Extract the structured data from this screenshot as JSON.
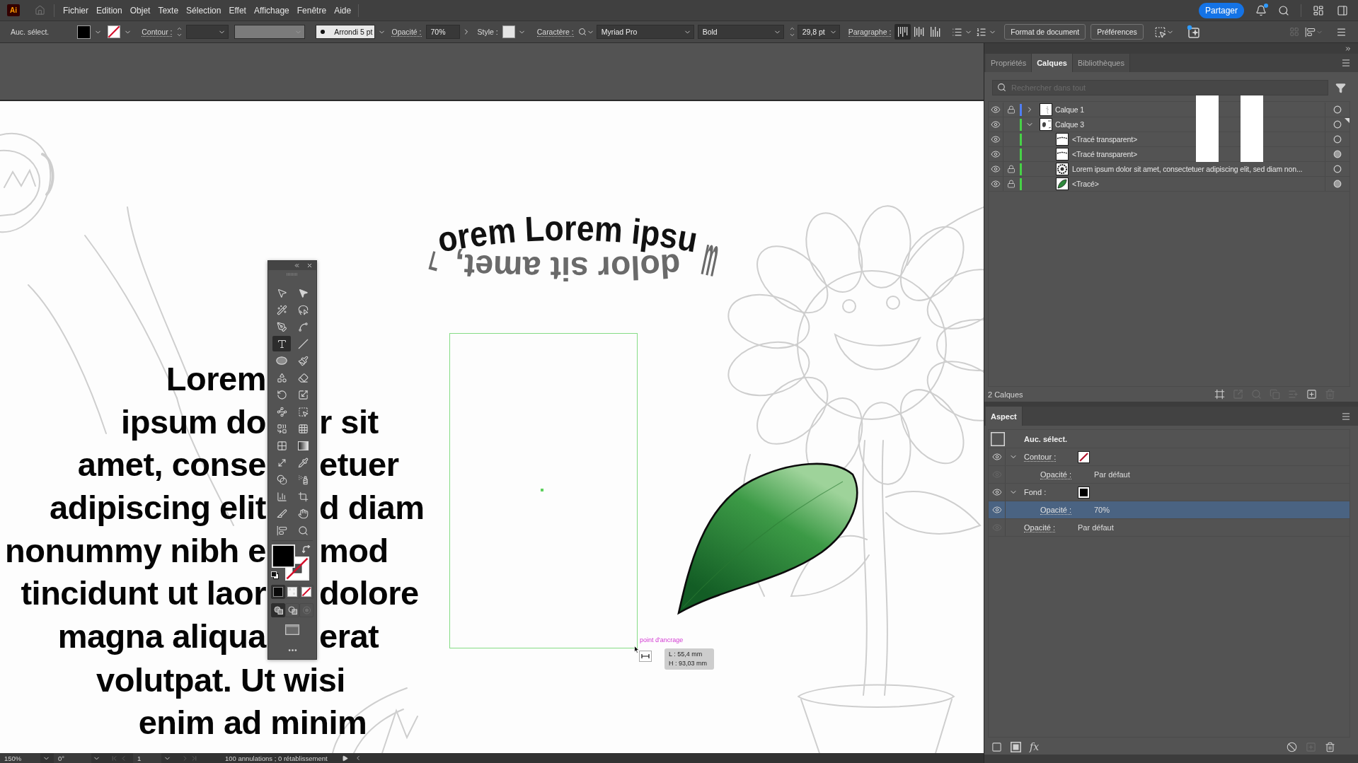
{
  "menu_bar": {
    "logo": "Ai",
    "items": [
      "Fichier",
      "Edition",
      "Objet",
      "Texte",
      "Sélection",
      "Effet",
      "Affichage",
      "Fenêtre",
      "Aide"
    ],
    "share_button": "Partager",
    "notification_dot": true
  },
  "control_bar": {
    "selection": "Auc. sélect.",
    "fill": {
      "color": "#000000"
    },
    "stroke": {
      "none": true
    },
    "stroke_label": "Contour :",
    "profile_disabled": true,
    "brush": "Arrondi 5 pt",
    "opacity_label": "Opacité :",
    "opacity": "70%",
    "style_label": "Style :",
    "character_label": "Caractère :",
    "font_family": "Myriad Pro",
    "font_style": "Bold",
    "font_size": "29,8 pt",
    "paragraph_label": "Paragraphe :",
    "alignments": [
      {
        "kind": "top",
        "selected": true
      },
      {
        "kind": "center",
        "selected": false
      },
      {
        "kind": "bottom",
        "selected": false
      }
    ],
    "buttons": [
      "Format de document",
      "Préférences"
    ]
  },
  "tool_panel": {
    "tools": [
      {
        "kind": "selection",
        "selected": false
      },
      {
        "kind": "direct-selection",
        "selected": false
      },
      {
        "kind": "magic-wand",
        "selected": false
      },
      {
        "kind": "lasso",
        "selected": false
      },
      {
        "kind": "pen",
        "selected": false
      },
      {
        "kind": "curvature",
        "selected": false
      },
      {
        "kind": "type",
        "selected": true
      },
      {
        "kind": "line",
        "selected": false
      },
      {
        "kind": "ellipse",
        "selected": false
      },
      {
        "kind": "paintbrush",
        "selected": false
      },
      {
        "kind": "shaper",
        "selected": false
      },
      {
        "kind": "eraser",
        "selected": false
      },
      {
        "kind": "rotate",
        "selected": false
      },
      {
        "kind": "scale",
        "selected": false
      },
      {
        "kind": "puppet-warp",
        "selected": false
      },
      {
        "kind": "free-transform",
        "selected": false
      },
      {
        "kind": "shape-builder",
        "selected": false
      },
      {
        "kind": "perspective",
        "selected": false
      },
      {
        "kind": "mesh",
        "selected": false
      },
      {
        "kind": "gradient",
        "selected": false
      },
      {
        "kind": "width",
        "selected": false
      },
      {
        "kind": "eyedropper",
        "selected": false
      },
      {
        "kind": "blend",
        "selected": false
      },
      {
        "kind": "sprayer",
        "selected": false
      },
      {
        "kind": "graph",
        "selected": false
      },
      {
        "kind": "artboard",
        "selected": false
      },
      {
        "kind": "slice",
        "selected": false
      },
      {
        "kind": "hand",
        "selected": false
      },
      {
        "kind": "arrange",
        "selected": false
      },
      {
        "kind": "zoom",
        "selected": false
      }
    ],
    "fill": {
      "color": "#000000"
    },
    "stroke": {
      "none": true
    },
    "color_modes": [
      {
        "kind": "color",
        "selected": true
      },
      {
        "kind": "gradient",
        "selected": false
      },
      {
        "kind": "none",
        "selected": false
      }
    ],
    "draw_modes": [
      {
        "kind": "normal",
        "selected": true
      },
      {
        "kind": "behind",
        "selected": false
      },
      {
        "kind": "inside",
        "selected": false
      }
    ]
  },
  "canvas": {
    "arc_text_top": "orem Lorem ipsu",
    "arc_text_right": "m",
    "arc_text_bottom": "dolor sit amet,",
    "arc_text_left": "L",
    "text_lines": [
      {
        "segments": [
          "Lorem"
        ]
      },
      {
        "segments": [
          "ipsum do",
          "r sit"
        ]
      },
      {
        "segments": [
          "amet, conse",
          "etuer"
        ]
      },
      {
        "segments": [
          "adipiscing elit",
          "d diam"
        ]
      },
      {
        "segments": [
          "nonummy nibh e",
          "mod"
        ]
      },
      {
        "segments": [
          "tincidunt ut laor",
          "dolore"
        ]
      },
      {
        "segments": [
          "magna aliqua",
          "erat"
        ]
      },
      {
        "segments": [
          "volutpat. Ut wisi"
        ]
      },
      {
        "segments": [
          "enim ad minim"
        ]
      }
    ],
    "anchor_hint": "point d'ancrage",
    "measure": [
      "L : 55,4 mm",
      "H : 93,03 mm"
    ]
  },
  "layers_panel": {
    "tabs": [
      {
        "label": "Propriétés",
        "selected": false
      },
      {
        "label": "Calques",
        "selected": true
      },
      {
        "label": "Bibliothèques",
        "selected": false
      }
    ],
    "search_placeholder": "Rechercher dans tout",
    "layers": [
      {
        "name": "Calque 1",
        "kind": "sketch",
        "visible": true,
        "locked": true,
        "expanded": false,
        "current": false,
        "color": "#4f7ef5",
        "target_filled": false
      },
      {
        "name": "Calque 3",
        "kind": "artwork",
        "visible": true,
        "locked": false,
        "expanded": true,
        "current": true,
        "color": "#47d147",
        "target_filled": false,
        "children": [
          {
            "name": "<Tracé transparent>",
            "kind": "curve",
            "visible": true,
            "locked": false,
            "target_filled": false
          },
          {
            "name": "<Tracé transparent>",
            "kind": "curve",
            "visible": true,
            "locked": false,
            "target_filled": true
          },
          {
            "name": "Lorem ipsum dolor sit amet, consectetuer adipiscing elit, sed diam non...",
            "kind": "emblem",
            "visible": true,
            "locked": true,
            "target_filled": false
          },
          {
            "name": "<Tracé>",
            "kind": "leaf",
            "visible": true,
            "locked": true,
            "target_filled": true
          }
        ]
      }
    ],
    "footer": "2 Calques",
    "footer_tools": [
      {
        "kind": "collect",
        "disabled": false
      },
      {
        "kind": "export",
        "disabled": true
      },
      {
        "kind": "locate",
        "disabled": true
      },
      {
        "kind": "clip",
        "disabled": true
      },
      {
        "kind": "sublayer",
        "disabled": true
      },
      {
        "kind": "new-layer",
        "disabled": false
      },
      {
        "kind": "delete",
        "disabled": true
      }
    ]
  },
  "appearance_panel": {
    "tab": "Aspect",
    "title": "Auc. sélect.",
    "attributes": [
      {
        "kind": "stroke",
        "label": "Contour :",
        "swatch": {
          "none": true
        },
        "expanded": true,
        "eye_active": true,
        "selected": false,
        "children": [
          {
            "kind": "opacity",
            "label": "Opacité :",
            "value": "Par défaut",
            "eye_active": false,
            "selected": false
          }
        ]
      },
      {
        "kind": "fill",
        "label": "Fond :",
        "swatch": {
          "color": "#000000"
        },
        "expanded": true,
        "eye_active": true,
        "selected": false,
        "children": [
          {
            "kind": "opacity",
            "label": "Opacité :",
            "value": "70%",
            "eye_active": true,
            "selected": true
          }
        ]
      },
      {
        "kind": "opacity",
        "label": "Opacité :",
        "value": "Par défaut",
        "eye_active": false,
        "selected": false
      }
    ],
    "footer_left": [
      {
        "kind": "new-stroke",
        "disabled": false
      },
      {
        "kind": "new-fill",
        "disabled": false
      },
      {
        "kind": "fx",
        "label": "fx",
        "disabled": false
      }
    ],
    "footer_right": [
      {
        "kind": "clear",
        "disabled": false
      },
      {
        "kind": "duplicate",
        "disabled": true
      },
      {
        "kind": "delete",
        "disabled": false
      }
    ]
  },
  "status_bar": {
    "zoom": "150%",
    "rotation": "0°",
    "artboard": "1",
    "history": "100 annulations ; 0 rétablissement"
  }
}
